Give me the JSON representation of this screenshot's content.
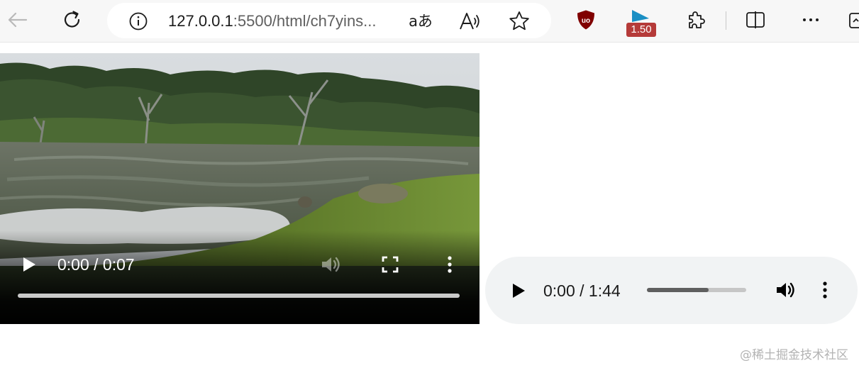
{
  "browser": {
    "url_host": "127.0.0.1",
    "url_path": ":5500/html/ch7yins...",
    "translate_glyph": "aあ",
    "playback_speed_badge": "1.50",
    "accent_colors": {
      "ublock": "#800000",
      "speed_badge": "#b53b39",
      "speed_icon": "#1a8fc4"
    }
  },
  "video": {
    "time_display": "0:00 / 0:07",
    "progress_fraction": 0,
    "icons": [
      "play-icon",
      "volume-icon",
      "fullscreen-icon",
      "more-options-icon"
    ]
  },
  "audio": {
    "time_display": "0:00 / 1:44",
    "volume_fraction": 0.62,
    "icons": [
      "play-icon",
      "volume-icon",
      "more-options-icon"
    ]
  },
  "watermark": "@稀土掘金技术社区"
}
